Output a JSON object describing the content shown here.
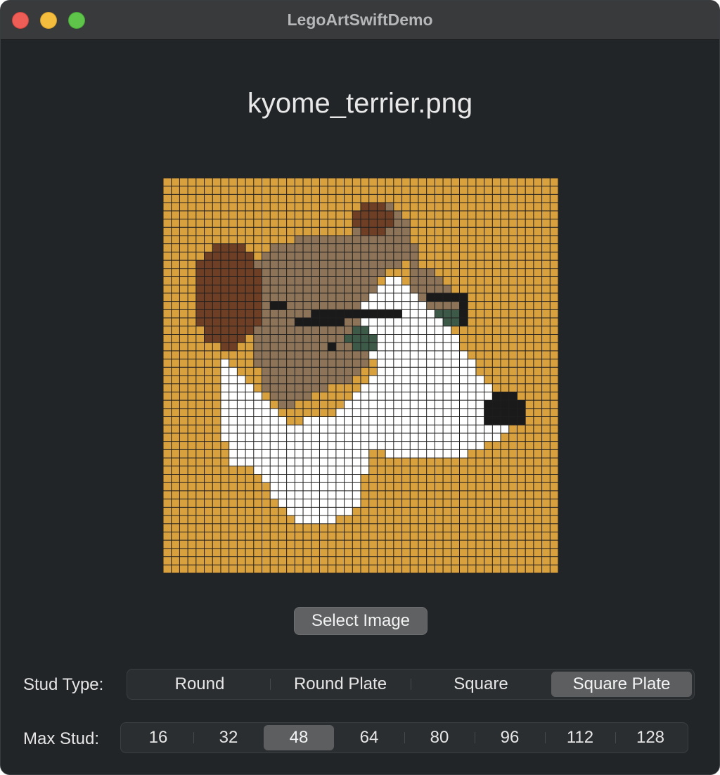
{
  "window": {
    "title": "LegoArtSwiftDemo",
    "controls": [
      "close",
      "minimize",
      "zoom"
    ]
  },
  "main": {
    "file_title": "kyome_terrier.png",
    "select_button_label": "Select Image"
  },
  "stud_type": {
    "label": "Stud Type:",
    "options": [
      "Round",
      "Round Plate",
      "Square",
      "Square Plate"
    ],
    "selected": "Square Plate"
  },
  "max_stud": {
    "label": "Max Stud:",
    "options": [
      "16",
      "32",
      "48",
      "64",
      "80",
      "96",
      "112",
      "128"
    ],
    "selected": "48"
  },
  "mosaic": {
    "grid_size": 48,
    "background_color": "#d9a03e",
    "grid_line_color": "#1e1e1e",
    "palette": {
      "dark_brown": "#6e3e25",
      "tan": "#8d7458",
      "white": "#ffffff",
      "black": "#1a1a1a",
      "green": "#3d5a48"
    }
  }
}
